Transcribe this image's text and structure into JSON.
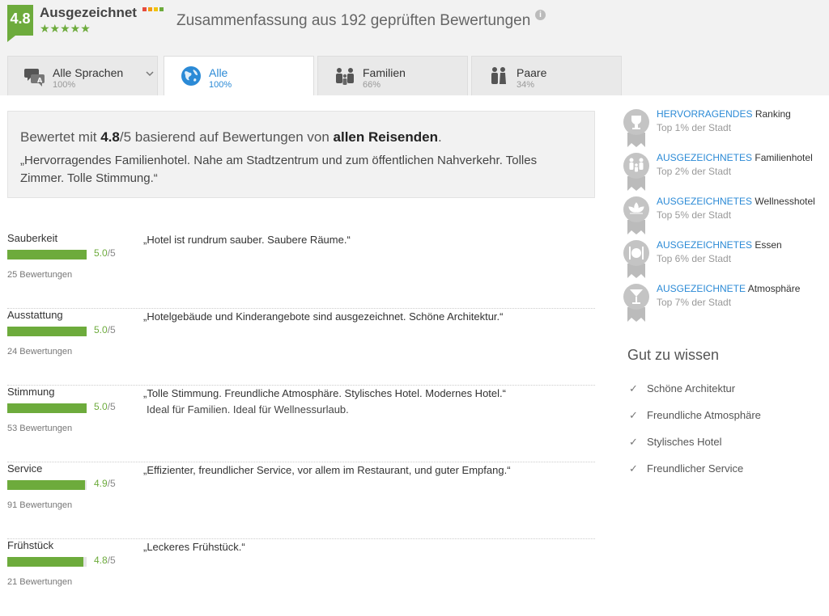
{
  "header": {
    "score": "4.8",
    "grade": "Ausgezeichnet",
    "grade_colors": [
      "#e74c3c",
      "#f39c12",
      "#f1c40f",
      "#6dab3c"
    ],
    "stars": "★★★★★",
    "summary": "Zusammenfassung aus 192 geprüften Bewertungen",
    "info_icon": "i"
  },
  "tabs": [
    {
      "label": "Alle Sprachen",
      "pct": "100%",
      "icon": "speech-bubbles-icon"
    },
    {
      "label": "Alle",
      "pct": "100%",
      "icon": "globe-icon"
    },
    {
      "label": "Familien",
      "pct": "66%",
      "icon": "family-icon"
    },
    {
      "label": "Paare",
      "pct": "34%",
      "icon": "couple-icon"
    }
  ],
  "verdict": {
    "prefix": "Bewertet mit ",
    "score": "4.8",
    "mid": "/5 basierend auf Bewertungen von ",
    "group": "allen Reisenden",
    "suffix": ".",
    "quote": "„Hervorragendes Familienhotel. Nahe am Stadtzentrum und zum öffentlichen Nahverkehr. Tolles Zimmer. Tolle Stimmung.“"
  },
  "categories": [
    {
      "name": "Sauberkeit",
      "score": "5.0",
      "max": "/5",
      "value": 1.0,
      "count": "25 Bewertungen",
      "quote": "„Hotel ist rundrum sauber. Saubere Räume.“",
      "extra": ""
    },
    {
      "name": "Ausstattung",
      "score": "5.0",
      "max": "/5",
      "value": 1.0,
      "count": "24 Bewertungen",
      "quote": "„Hotelgebäude und Kinderangebote sind ausgezeichnet. Schöne Architektur.“",
      "extra": ""
    },
    {
      "name": "Stimmung",
      "score": "5.0",
      "max": "/5",
      "value": 1.0,
      "count": "53 Bewertungen",
      "quote": "„Tolle Stimmung. Freundliche Atmosphäre. Stylisches Hotel. Modernes Hotel.“",
      "extra": "Ideal für Familien. Ideal für Wellnessurlaub."
    },
    {
      "name": "Service",
      "score": "4.9",
      "max": "/5",
      "value": 0.98,
      "count": "91 Bewertungen",
      "quote": "„Effizienter, freundlicher Service, vor allem im Restaurant, und guter Empfang.“",
      "extra": ""
    },
    {
      "name": "Frühstück",
      "score": "4.8",
      "max": "/5",
      "value": 0.96,
      "count": "21 Bewertungen",
      "quote": "„Leckeres Frühstück.“",
      "extra": ""
    }
  ],
  "awards": [
    {
      "highlight": "HERVORRAGENDES",
      "rest": " Ranking",
      "sub": "Top 1% der Stadt",
      "icon": "trophy-icon"
    },
    {
      "highlight": "AUSGEZEICHNETES",
      "rest": " Familienhotel",
      "sub": "Top 2% der Stadt",
      "icon": "family-icon"
    },
    {
      "highlight": "AUSGEZEICHNETES",
      "rest": " Wellnesshotel",
      "sub": "Top 5% der Stadt",
      "icon": "lotus-icon"
    },
    {
      "highlight": "AUSGEZEICHNETES",
      "rest": " Essen",
      "sub": "Top 6% der Stadt",
      "icon": "cutlery-icon"
    },
    {
      "highlight": "AUSGEZEICHNETE",
      "rest": " Atmosphäre",
      "sub": "Top 7% der Stadt",
      "icon": "cocktail-icon"
    }
  ],
  "good_to_know": {
    "title": "Gut zu wissen",
    "items": [
      "Schöne Architektur",
      "Freundliche Atmosphäre",
      "Stylisches Hotel",
      "Freundlicher Service"
    ]
  }
}
